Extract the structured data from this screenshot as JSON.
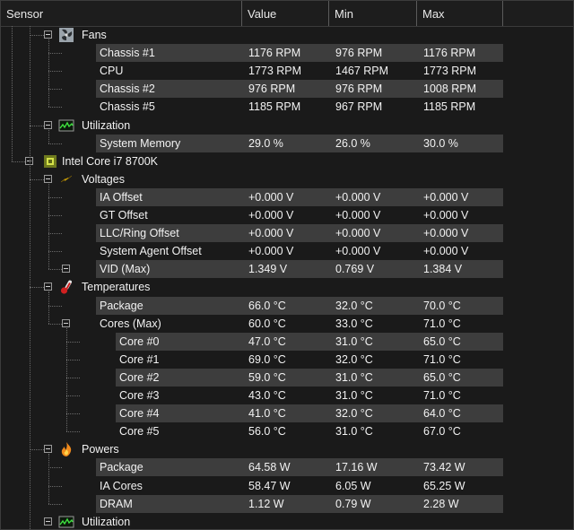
{
  "columns": {
    "sensor": "Sensor",
    "value": "Value",
    "min": "Min",
    "max": "Max"
  },
  "rows": [
    {
      "depth": 1,
      "kind": "group",
      "label": "Fans",
      "icon": "fan-icon"
    },
    {
      "depth": 2,
      "kind": "item",
      "label": "Chassis #1",
      "value": "1176 RPM",
      "min": "976 RPM",
      "max": "1176 RPM"
    },
    {
      "depth": 2,
      "kind": "item",
      "label": "CPU",
      "value": "1773 RPM",
      "min": "1467 RPM",
      "max": "1773 RPM"
    },
    {
      "depth": 2,
      "kind": "item",
      "label": "Chassis #2",
      "value": "976 RPM",
      "min": "976 RPM",
      "max": "1008 RPM"
    },
    {
      "depth": 2,
      "kind": "item",
      "label": "Chassis #5",
      "value": "1185 RPM",
      "min": "967 RPM",
      "max": "1185 RPM"
    },
    {
      "depth": 1,
      "kind": "group",
      "label": "Utilization",
      "icon": "utilization-icon"
    },
    {
      "depth": 2,
      "kind": "item",
      "label": "System Memory",
      "value": "29.0 %",
      "min": "26.0 %",
      "max": "30.0 %"
    },
    {
      "depth": 0,
      "kind": "group",
      "label": "Intel Core i7 8700K",
      "icon": "cpu-chip-icon"
    },
    {
      "depth": 1,
      "kind": "group",
      "label": "Voltages",
      "icon": "voltage-icon"
    },
    {
      "depth": 2,
      "kind": "item",
      "label": "IA Offset",
      "value": "+0.000 V",
      "min": "+0.000 V",
      "max": "+0.000 V"
    },
    {
      "depth": 2,
      "kind": "item",
      "label": "GT Offset",
      "value": "+0.000 V",
      "min": "+0.000 V",
      "max": "+0.000 V"
    },
    {
      "depth": 2,
      "kind": "item",
      "label": "LLC/Ring Offset",
      "value": "+0.000 V",
      "min": "+0.000 V",
      "max": "+0.000 V"
    },
    {
      "depth": 2,
      "kind": "item",
      "label": "System Agent Offset",
      "value": "+0.000 V",
      "min": "+0.000 V",
      "max": "+0.000 V"
    },
    {
      "depth": 2,
      "kind": "item",
      "label": "VID (Max)",
      "value": "1.349 V",
      "min": "0.769 V",
      "max": "1.384 V",
      "expander": true
    },
    {
      "depth": 1,
      "kind": "group",
      "label": "Temperatures",
      "icon": "thermometer-icon"
    },
    {
      "depth": 2,
      "kind": "item",
      "label": "Package",
      "value": "66.0 °C",
      "min": "32.0 °C",
      "max": "70.0 °C"
    },
    {
      "depth": 2,
      "kind": "item",
      "label": "Cores (Max)",
      "value": "60.0 °C",
      "min": "33.0 °C",
      "max": "71.0 °C",
      "expander": true
    },
    {
      "depth": 3,
      "kind": "item",
      "label": "Core #0",
      "value": "47.0 °C",
      "min": "31.0 °C",
      "max": "65.0 °C"
    },
    {
      "depth": 3,
      "kind": "item",
      "label": "Core #1",
      "value": "69.0 °C",
      "min": "32.0 °C",
      "max": "71.0 °C"
    },
    {
      "depth": 3,
      "kind": "item",
      "label": "Core #2",
      "value": "59.0 °C",
      "min": "31.0 °C",
      "max": "65.0 °C"
    },
    {
      "depth": 3,
      "kind": "item",
      "label": "Core #3",
      "value": "43.0 °C",
      "min": "31.0 °C",
      "max": "71.0 °C"
    },
    {
      "depth": 3,
      "kind": "item",
      "label": "Core #4",
      "value": "41.0 °C",
      "min": "32.0 °C",
      "max": "64.0 °C"
    },
    {
      "depth": 3,
      "kind": "item",
      "label": "Core #5",
      "value": "56.0 °C",
      "min": "31.0 °C",
      "max": "67.0 °C"
    },
    {
      "depth": 1,
      "kind": "group",
      "label": "Powers",
      "icon": "flame-icon"
    },
    {
      "depth": 2,
      "kind": "item",
      "label": "Package",
      "value": "64.58 W",
      "min": "17.16 W",
      "max": "73.42 W"
    },
    {
      "depth": 2,
      "kind": "item",
      "label": "IA Cores",
      "value": "58.47 W",
      "min": "6.05 W",
      "max": "65.25 W"
    },
    {
      "depth": 2,
      "kind": "item",
      "label": "DRAM",
      "value": "1.12 W",
      "min": "0.79 W",
      "max": "2.28 W"
    },
    {
      "depth": 1,
      "kind": "group",
      "label": "Utilization",
      "icon": "utilization-icon"
    }
  ]
}
